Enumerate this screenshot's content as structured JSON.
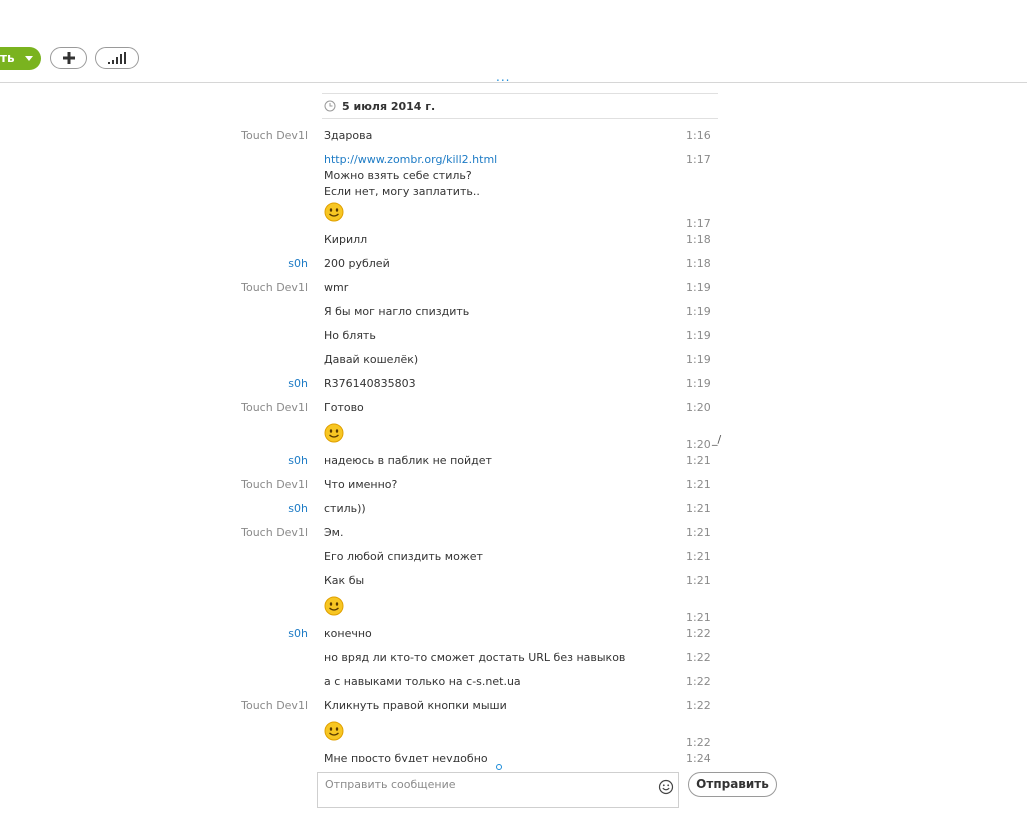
{
  "toolbar": {
    "call_button_label": "ть",
    "add_icon": "plus-icon",
    "signal_icon": "signal-bars-icon",
    "more_indicator": "..."
  },
  "conversation": {
    "date_label": "5 июля 2014 г.",
    "messages": [
      {
        "sender": "Touch Dev1l",
        "side": "other",
        "text": "Здарова",
        "time": "1:16"
      },
      {
        "sender": "",
        "side": "other",
        "link": "http://www.zombr.org/kill2.html",
        "lines": [
          "Можно взять себе стиль?",
          "Если нет, могу заплатить.."
        ],
        "time": "1:17"
      },
      {
        "sender": "",
        "side": "other",
        "emoji": "smiley-emoticon",
        "time": "1:17"
      },
      {
        "sender": "",
        "side": "other",
        "text": "Кирилл",
        "time": "1:18"
      },
      {
        "sender": "s0h",
        "side": "me",
        "text": "200 рублей",
        "time": "1:18"
      },
      {
        "sender": "Touch Dev1l",
        "side": "other",
        "text": "wmr",
        "time": "1:19"
      },
      {
        "sender": "",
        "side": "other",
        "text": "Я бы мог нагло спиздить",
        "time": "1:19"
      },
      {
        "sender": "",
        "side": "other",
        "text": "Но блять",
        "time": "1:19"
      },
      {
        "sender": "",
        "side": "other",
        "text": "Давай кошелёк)",
        "time": "1:19"
      },
      {
        "sender": "s0h",
        "side": "me",
        "text": "R376140835803",
        "time": "1:19"
      },
      {
        "sender": "Touch Dev1l",
        "side": "other",
        "text": "Готово",
        "time": "1:20"
      },
      {
        "sender": "",
        "side": "other",
        "emoji": "smiley-emoticon",
        "time": "1:20",
        "mark": "_/"
      },
      {
        "sender": "s0h",
        "side": "me",
        "text": "надеюсь в паблик не пойдет",
        "time": "1:21"
      },
      {
        "sender": "Touch Dev1l",
        "side": "other",
        "text": "Что именно?",
        "time": "1:21"
      },
      {
        "sender": "s0h",
        "side": "me",
        "text": "стиль))",
        "time": "1:21"
      },
      {
        "sender": "Touch Dev1l",
        "side": "other",
        "text": "Эм.",
        "time": "1:21"
      },
      {
        "sender": "",
        "side": "other",
        "text": "Его любой спиздить может",
        "time": "1:21"
      },
      {
        "sender": "",
        "side": "other",
        "text": "Как бы",
        "time": "1:21"
      },
      {
        "sender": "",
        "side": "other",
        "emoji": "smiley-emoticon",
        "time": "1:21"
      },
      {
        "sender": "s0h",
        "side": "me",
        "text": "конечно",
        "time": "1:22"
      },
      {
        "sender": "",
        "side": "me",
        "text": "но вряд ли кто-то сможет достать URL без навыков",
        "time": "1:22"
      },
      {
        "sender": "",
        "side": "me",
        "text": "а с навыками только на c-s.net.ua",
        "time": "1:22"
      },
      {
        "sender": "Touch Dev1l",
        "side": "other",
        "text": "Кликнуть правой кнопки мыши",
        "time": "1:22"
      },
      {
        "sender": "",
        "side": "other",
        "emoji": "smiley-emoticon",
        "time": "1:22"
      },
      {
        "sender": "",
        "side": "other",
        "text": "Мне просто будет неудобно",
        "time": "1:24"
      }
    ]
  },
  "composer": {
    "placeholder": "Отправить сообщение",
    "emoji_icon": "smiley-icon",
    "send_label": "Отправить"
  }
}
